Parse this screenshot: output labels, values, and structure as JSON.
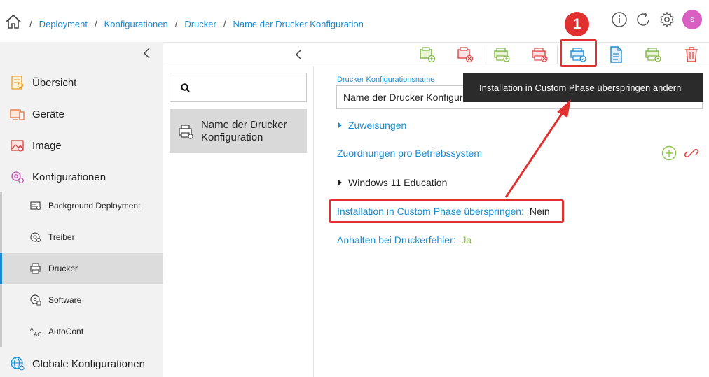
{
  "breadcrumb": {
    "items": [
      "Deployment",
      "Konfigurationen",
      "Drucker",
      "Name der Drucker Konfiguration"
    ],
    "separator": "/"
  },
  "header": {
    "avatar_initial": "s",
    "icons": [
      "home-icon",
      "info-icon",
      "refresh-icon",
      "gear-icon"
    ]
  },
  "sidebar": {
    "items": [
      {
        "label": "Übersicht",
        "icon": "overview-icon"
      },
      {
        "label": "Geräte",
        "icon": "devices-icon"
      },
      {
        "label": "Image",
        "icon": "image-icon"
      },
      {
        "label": "Konfigurationen",
        "icon": "configurations-icon"
      },
      {
        "label": "Globale Konfigurationen",
        "icon": "global-config-icon"
      }
    ],
    "subitems": [
      {
        "label": "Background Deployment",
        "icon": "background-deployment-icon"
      },
      {
        "label": "Treiber",
        "icon": "driver-icon"
      },
      {
        "label": "Drucker",
        "icon": "printer-icon",
        "active": true
      },
      {
        "label": "Software",
        "icon": "software-icon"
      },
      {
        "label": "AutoConf",
        "icon": "autoconf-icon"
      }
    ]
  },
  "search": {
    "placeholder": "",
    "value": ""
  },
  "list": {
    "items": [
      {
        "label": "Name der Drucker Konfiguration",
        "icon": "printer-icon"
      }
    ]
  },
  "detail": {
    "name_label": "Drucker Konfigurationsname",
    "name_value": "Name der Drucker Konfiguration",
    "assignments": "Zuweisungen",
    "os_mapping": "Zuordnungen pro Betriebssystem",
    "os_entry": "Windows 11 Education",
    "skip_install_label": "Installation in Custom Phase überspringen:",
    "skip_install_value": "Nein",
    "halt_on_error_label": "Anhalten bei Druckerfehler:",
    "halt_on_error_value": "Ja"
  },
  "tooltip": {
    "text": "Installation in Custom Phase überspringen ändern"
  },
  "annotation": {
    "badge": "1"
  },
  "colors": {
    "accent": "#1a8ad0",
    "green": "#8bc34a",
    "red": "#e03030",
    "avatar": "#d95fc3",
    "sidebar_bg": "#f2f2f2",
    "active_bg": "#dcdcdc",
    "tooltip_bg": "#2b2b2b"
  }
}
